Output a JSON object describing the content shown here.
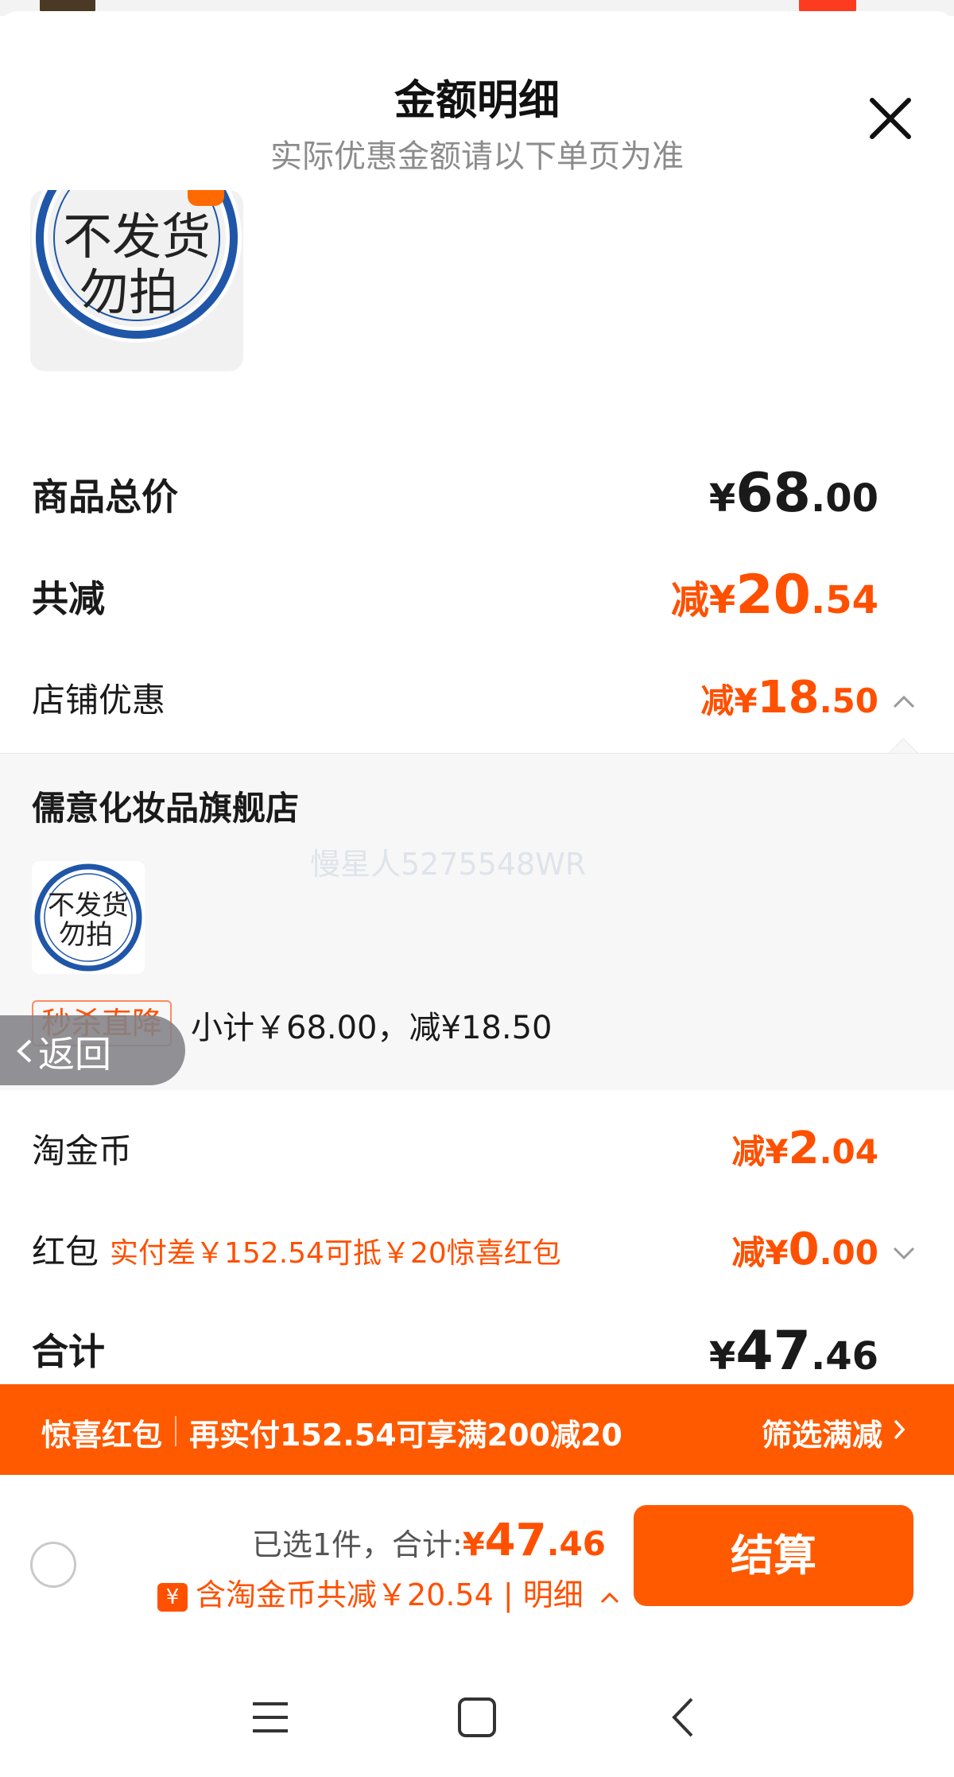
{
  "colors": {
    "accent": "#ff5000",
    "promo_bar": "#ff5a00"
  },
  "sheet": {
    "title": "金额明细",
    "subtitle": "实际优惠金额请以下单页为准",
    "close_icon": "close-icon"
  },
  "summary": {
    "total_label": "商品总价",
    "total_cur": "¥",
    "total_int": "68",
    "total_dec": ".00",
    "discount_label": "共减",
    "discount_prefix": "减¥",
    "discount_int": "20",
    "discount_dec": ".54",
    "store_label": "店铺优惠",
    "store_prefix": "减¥",
    "store_int": "18",
    "store_dec": ".50"
  },
  "store": {
    "name": "儒意化妆品旗舰店",
    "watermark": "慢星人5275548WR",
    "tag": "秒杀直降",
    "subtotal": "小计￥68.00，减¥18.50",
    "product_stamp_line1": "不发货",
    "product_stamp_line2": "勿拍"
  },
  "back": {
    "label": "返回"
  },
  "coins": {
    "label": "淘金币",
    "prefix": "减¥",
    "int": "2",
    "dec": ".04"
  },
  "hongbao": {
    "label": "红包",
    "hint": "实付差￥152.54可抵￥20惊喜红包",
    "prefix": "减¥",
    "int": "0",
    "dec": ".00"
  },
  "grand_total": {
    "label": "合计",
    "cur": "¥",
    "int": "47",
    "dec": ".46"
  },
  "promo_bar": {
    "title": "惊喜红包",
    "text": "再实付152.54可享满200减20",
    "action": "筛选满减"
  },
  "footer": {
    "selected": "已选1件，合计:",
    "price_cur": "¥",
    "price_int": "47",
    "price_dec": ".46",
    "coin_badge": "¥",
    "coin_text": "含淘金币共减￥20.54 | 明细",
    "checkout": "结算"
  }
}
